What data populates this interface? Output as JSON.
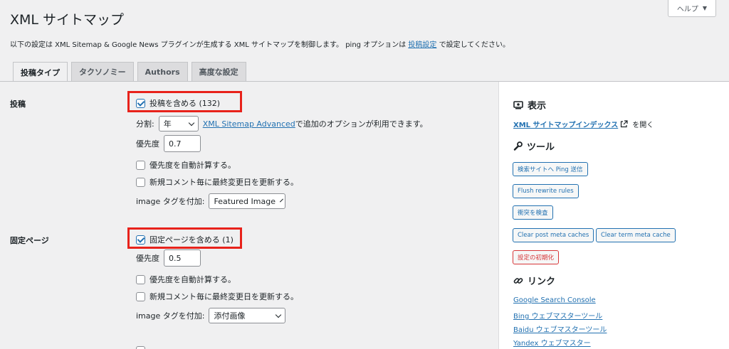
{
  "page": {
    "title": "XML サイトマップ",
    "help_label": "ヘルプ",
    "intro_before": "以下の設定は XML Sitemap & Google News プラグインが生成する XML サイトマップを制御します。 ping オプションは ",
    "intro_link": "投稿設定",
    "intro_after": " で設定してください。"
  },
  "tabs": [
    {
      "label": "投稿タイプ",
      "active": true
    },
    {
      "label": "タクソノミー",
      "active": false
    },
    {
      "label": "Authors",
      "active": false
    },
    {
      "label": "高度な設定",
      "active": false
    }
  ],
  "posts": {
    "label": "投稿",
    "include_label": "投稿を含める (132)",
    "include_checked": true,
    "split_label": "分割:",
    "split_value": "年",
    "advanced_link": "XML Sitemap Advanced",
    "advanced_after": " で追加のオプションが利用できます。",
    "priority_label": "優先度",
    "priority_value": "0.7",
    "auto_priority_label": "優先度を自動計算する。",
    "auto_priority_checked": false,
    "update_lastmod_label": "新規コメント毎に最終変更日を更新する。",
    "update_lastmod_checked": false,
    "image_label": "image タグを付加:",
    "image_value": "Featured Image"
  },
  "pages": {
    "label": "固定ページ",
    "include_label": "固定ページを含める (1)",
    "include_checked": true,
    "priority_label": "優先度",
    "priority_value": "0.5",
    "auto_priority_label": "優先度を自動計算する。",
    "auto_priority_checked": false,
    "update_lastmod_label": "新規コメント毎に最終変更日を更新する。",
    "update_lastmod_checked": false,
    "image_label": "image タグを付加:",
    "image_value": "添付画像"
  },
  "sidebar": {
    "view_heading": "表示",
    "index_link": "XML サイトマップインデックス",
    "index_after": "を開く",
    "tools_heading": "ツール",
    "tools": {
      "ping": "検索サイトへ Ping 送信",
      "flush": "Flush rewrite rules",
      "conflict": "衝突を検査",
      "clear_post_meta": "Clear post meta caches",
      "clear_term_meta": "Clear term meta cache",
      "reset": "設定の初期化"
    },
    "links_heading": "リンク",
    "links": {
      "google": "Google Search Console",
      "bing": "Bing ウェブマスターツール",
      "baidu": "Baidu ウェブマスターツール",
      "yandex": "Yandex ウェブマスター"
    }
  },
  "colors": {
    "highlight": "#e8221b",
    "accent": "#2271b1",
    "danger": "#d63638"
  }
}
